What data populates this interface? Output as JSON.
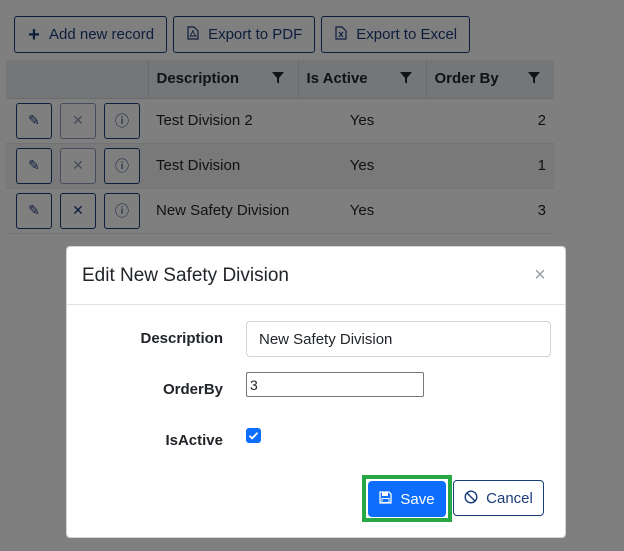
{
  "toolbar": {
    "add_label": "Add new record",
    "add_icon": "plus-icon",
    "pdf_label": "Export to PDF",
    "pdf_icon": "pdf-file-icon",
    "excel_label": "Export to Excel",
    "excel_icon": "excel-file-icon"
  },
  "grid": {
    "columns": [
      "Description",
      "Is Active",
      "Order By"
    ],
    "rows": [
      {
        "description": "Test Division 2",
        "is_active": "Yes",
        "order_by": "2"
      },
      {
        "description": "Test Division",
        "is_active": "Yes",
        "order_by": "1"
      },
      {
        "description": "New Safety Division",
        "is_active": "Yes",
        "order_by": "3"
      }
    ]
  },
  "modal": {
    "title": "Edit New Safety Division",
    "close_glyph": "×",
    "fields": {
      "description_label": "Description",
      "description_value": "New Safety Division",
      "orderby_label": "OrderBy",
      "orderby_value": "3",
      "isactive_label": "IsActive",
      "isactive_checked": true
    },
    "save_label": "Save",
    "cancel_label": "Cancel"
  },
  "colors": {
    "primary": "#0d6efd",
    "dark_blue": "#1a3d7a",
    "highlight": "#28a745"
  }
}
